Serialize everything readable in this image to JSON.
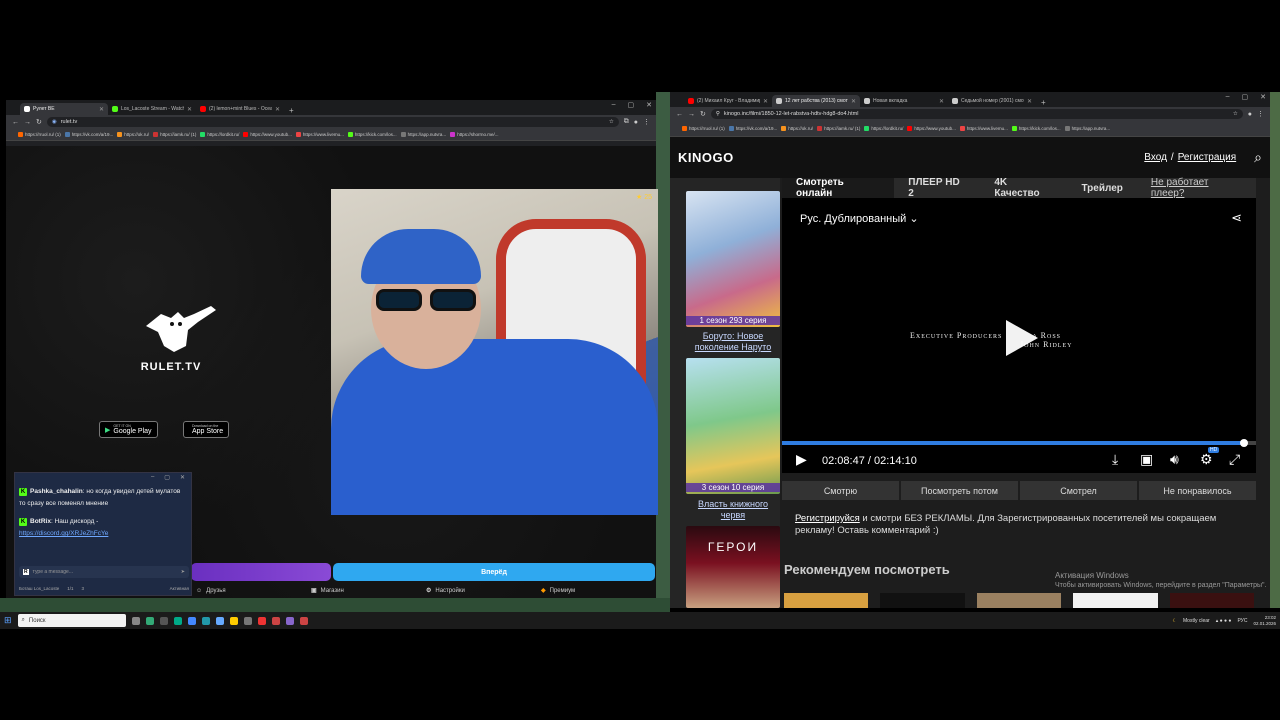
{
  "left_browser": {
    "tabs": [
      {
        "title": "Рулет ВЕ",
        "active": true,
        "color": "#ffffff"
      },
      {
        "title": "Los_Lacoste Stream - Watch Li",
        "active": false,
        "color": "#53fc18"
      },
      {
        "title": "(2) lemon+mint Blues - Ocean",
        "active": false,
        "color": "#ff0000"
      }
    ],
    "address": "rulet.tv",
    "bookmarks": [
      "https://rruol.ru/ (1)",
      "https://vk.com/a/19...",
      "https://ok.ru/",
      "https://iamk.ru/ (1)",
      "https://lordkit.ru/",
      "https://www.youtub...",
      "https://www.livemu...",
      "https://kick.com/los...",
      "https://app.nutvra...",
      "https://shorrno.me/..."
    ],
    "page": {
      "logo_text": "RULET.TV",
      "google_play_small": "GET IT ON",
      "google_play": "Google Play",
      "app_store_small": "Download on the",
      "app_store": "App Store",
      "video_counter": "25",
      "start_button": "Вперёд",
      "nav": [
        "Друзья",
        "Магазин",
        "Настройки",
        "Премиум"
      ]
    },
    "chat": {
      "messages": [
        {
          "user": "Pashka_chahalin",
          "text": "но когда увидел детей мулатов то сразу все поменял мнение"
        },
        {
          "user": "BotRix",
          "text": "Наш дискорд -"
        }
      ],
      "link": "https://discord.gg/XRJeZhFcYe",
      "input_placeholder": "туре а message...",
      "footer_user": "Боташ Los_Lacoste",
      "footer_count": "1/1",
      "footer_viewers": "3",
      "footer_right": "Активная"
    }
  },
  "right_browser": {
    "tabs": [
      {
        "title": "(2) Михаил Круг - Владимирс",
        "active": false,
        "color": "#ff0000"
      },
      {
        "title": "12 лет рабства (2013) смотре",
        "active": true,
        "color": "#cccccc"
      },
      {
        "title": "Новая вкладка",
        "active": false,
        "color": "#cccccc"
      },
      {
        "title": "Седьмой номер (2001) смотр",
        "active": false,
        "color": "#cccccc"
      }
    ],
    "address": "kinogo.inc/filmi/1850-12-let-rabstva-hdtv-hdg8-do4.html",
    "bookmarks": [
      "https://rruol.ru/ (1)",
      "https://vk.com/a/19...",
      "https://ok.ru/",
      "https://iamk.ru/ (1)",
      "https://lordkit.ru/",
      "https://www.youtub...",
      "https://www.livemu...",
      "https://kick.com/los...",
      "https://app.nutvra..."
    ],
    "site": {
      "logo": "KINOGO",
      "login": "Вход",
      "separator": "/",
      "register": "Регистрация",
      "sidebar": [
        {
          "tag": "1 сезон 293 серия",
          "title": "Боруто: Новое поколение Наруто"
        },
        {
          "tag": "3 сезон 10 серия",
          "title": "Власть книжного червя"
        },
        {
          "tag": "",
          "title": "ГЕРОИ"
        }
      ],
      "player_tabs": [
        "Смотреть онлайн",
        "ПЛЕЕР HD 2",
        "4K Качество",
        "Трейлер"
      ],
      "player_broken": "Не работает плеер?",
      "dub": "Рус. Дублированный",
      "credits_line1": "Executive Producers",
      "credits_line2_a": "a Ross",
      "credits_line2_b": "John Ridley",
      "progress": 0.975,
      "time": "02:08:47 / 02:14:10",
      "quality_badge": "HD",
      "actions": [
        "Смотрю",
        "Посмотреть потом",
        "Смотрел",
        "Не понравилось"
      ],
      "promo_link": "Регистрируйся",
      "promo_text": " и смотри БЕЗ РЕКЛАМЫ. Для Зарегистрированных посетителей мы сокращаем рекламу! Оставь комментарий :)",
      "recommend": "Рекомендуем посмотреть",
      "activation_title": "Активация Windows",
      "activation_text": "Чтобы активировать Windows, перейдите в раздел \"Параметры\"."
    }
  },
  "taskbar": {
    "search_placeholder": "Поиск",
    "weather": "Mostly clear",
    "lang": "РУС",
    "time": "23:02",
    "date": "02.01.2026"
  }
}
